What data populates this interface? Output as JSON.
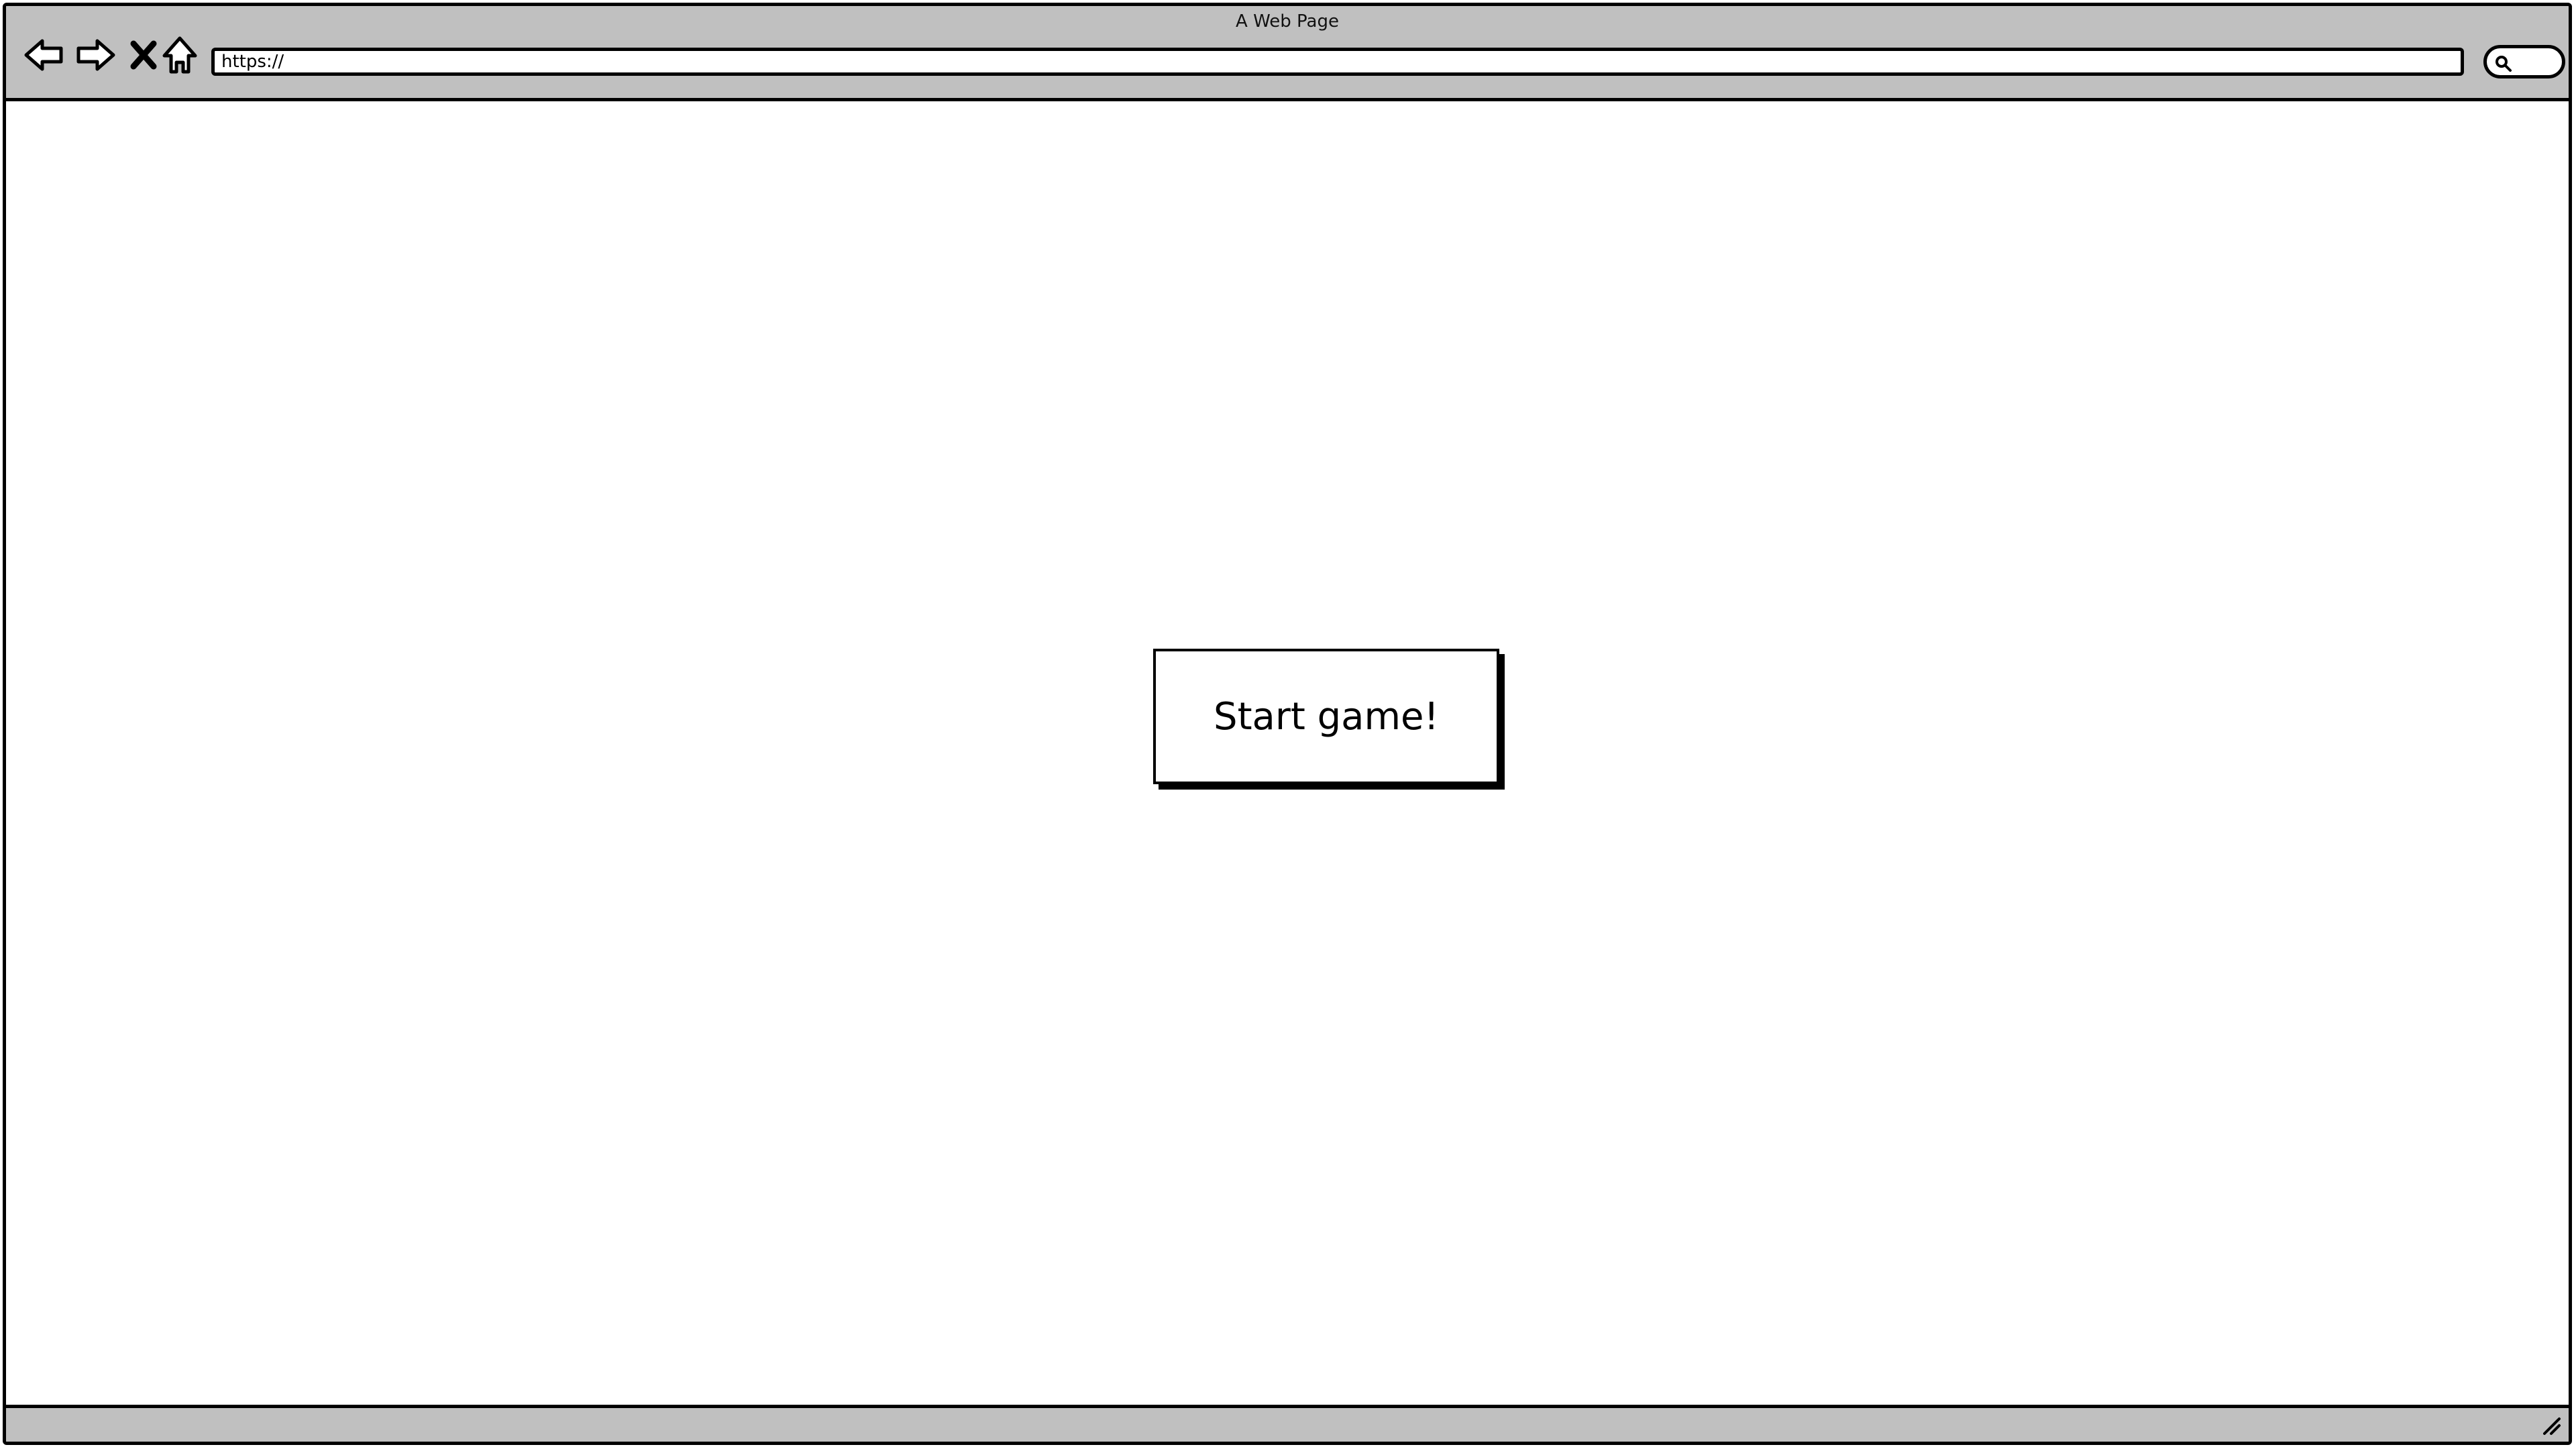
{
  "window": {
    "title": "A Web Page"
  },
  "toolbar": {
    "icons": [
      "back-arrow-icon",
      "forward-arrow-icon",
      "stop-icon",
      "home-icon"
    ],
    "address": "https://",
    "search_icon": "search-icon"
  },
  "main": {
    "start_button_label": "Start game!"
  },
  "colors": {
    "chrome": "#c0c0c0",
    "outline": "#000000",
    "page": "#ffffff"
  }
}
